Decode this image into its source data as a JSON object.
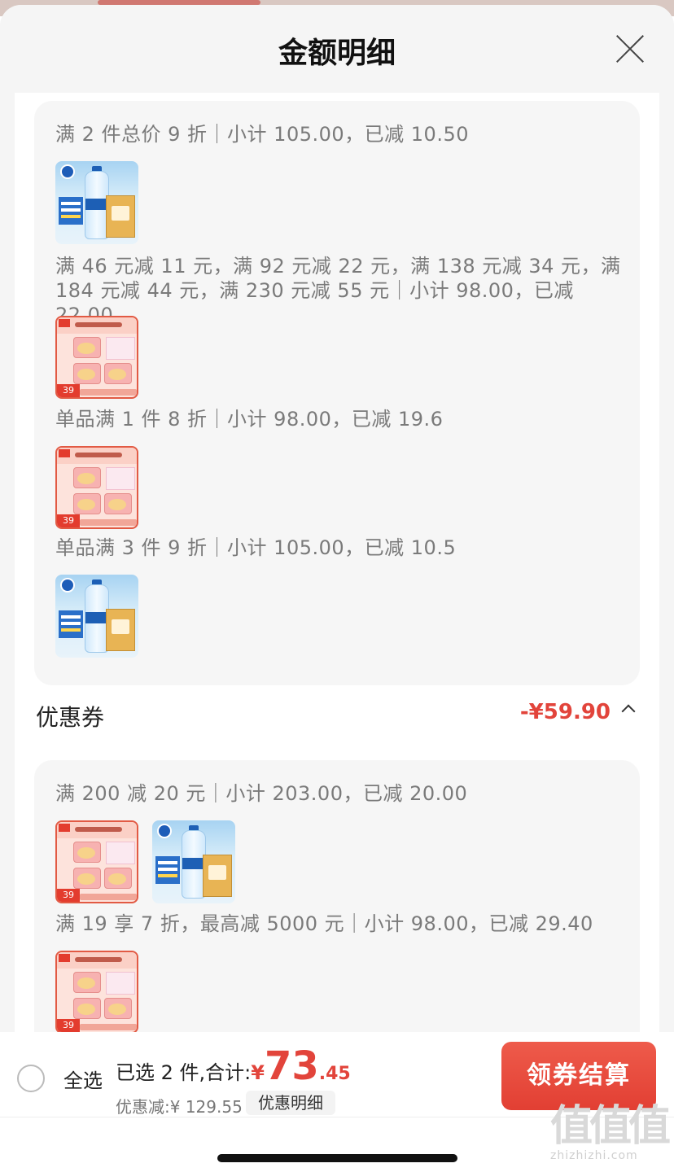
{
  "header": {
    "title": "金额明细"
  },
  "promotions": {
    "rules": [
      "满 2 件总价 9 折｜小计 105.00，已减 10.50",
      "满 46 元减 11 元，满 92 元减 22 元，满 138 元减 34 元，满 184 元减 44 元，满 230 元减 55 元｜小计 98.00，已减 22.00",
      "单品满 1 件 8 折｜小计 98.00，已减 19.6",
      "单品满 3 件 9 折｜小计 105.00，已减 10.5"
    ]
  },
  "coupon": {
    "label": "优惠券",
    "amount": "-¥59.90",
    "rules": [
      "满 200 减 20 元｜小计 203.00，已减 20.00",
      "满 19 享 7 折，最高减 5000 元｜小计 98.00，已减 29.40"
    ]
  },
  "products": {
    "water_icon": "water-bottle-product-thumbnail",
    "pods_icon": "laundry-pods-product-thumbnail",
    "pods_price_tag": "39"
  },
  "bottom_bar": {
    "select_all": "全选",
    "selected_text": "已选 2 件,合计:",
    "currency": "¥",
    "total_int": "73",
    "total_dec": ".45",
    "discount_text": "优惠减:¥ 129.55",
    "detail_button": "优惠明细",
    "checkout_button": "领券结算"
  },
  "watermark": {
    "glyph": "值值值",
    "url": "zhizhizhi.com"
  },
  "colors": {
    "accent": "#e2443b",
    "card_bg": "#f6f6f6",
    "sheet_bg": "#f5f5f5"
  }
}
